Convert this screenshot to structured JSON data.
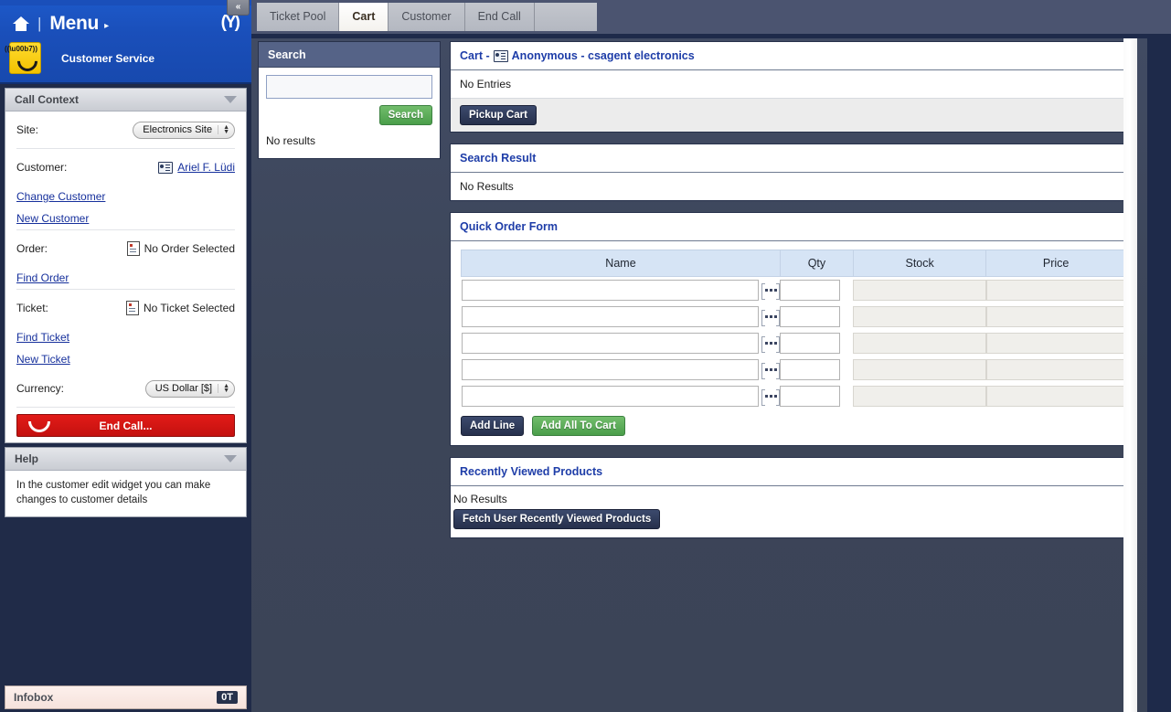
{
  "sidebar": {
    "menu_label": "Menu",
    "menu_arrow": "▸",
    "menu_divider": "|",
    "brand_mark": "(Ŷ)",
    "collapse_label": "«",
    "app_name": "Customer Service",
    "panels": {
      "call_context": {
        "title": "Call Context",
        "site_label": "Site:",
        "site_value": "Electronics Site",
        "customer_label": "Customer:",
        "customer_value": "Ariel F. Lüdi",
        "change_customer": "Change Customer",
        "new_customer": "New Customer",
        "order_label": "Order:",
        "order_value": "No Order Selected",
        "find_order": "Find Order",
        "ticket_label": "Ticket:",
        "ticket_value": "No Ticket Selected",
        "find_ticket": "Find Ticket",
        "new_ticket": "New Ticket",
        "currency_label": "Currency:",
        "currency_value": "US Dollar [$]",
        "end_call": "End Call..."
      },
      "help": {
        "title": "Help",
        "text": "In the customer edit widget you can make changes to customer details"
      }
    },
    "infobox": {
      "title": "Infobox",
      "badge": "0T"
    }
  },
  "tabs": [
    {
      "label": "Ticket Pool",
      "active": false
    },
    {
      "label": "Cart",
      "active": true
    },
    {
      "label": "Customer",
      "active": false
    },
    {
      "label": "End Call",
      "active": false
    }
  ],
  "search_widget": {
    "title": "Search",
    "input_value": "",
    "button_label": "Search",
    "result_text": "No results"
  },
  "cart": {
    "title_prefix": "Cart - ",
    "title_customer": "Anonymous - csagent electronics",
    "empty_text": "No Entries",
    "pickup_button": "Pickup Cart"
  },
  "search_result": {
    "title": "Search Result",
    "empty_text": "No Results"
  },
  "quick_order_form": {
    "title": "Quick Order Form",
    "columns": [
      "Name",
      "Qty",
      "Stock",
      "Price"
    ],
    "rows": [
      {
        "name": "",
        "qty": "",
        "stock": "",
        "price": ""
      },
      {
        "name": "",
        "qty": "",
        "stock": "",
        "price": ""
      },
      {
        "name": "",
        "qty": "",
        "stock": "",
        "price": ""
      },
      {
        "name": "",
        "qty": "",
        "stock": "",
        "price": ""
      },
      {
        "name": "",
        "qty": "",
        "stock": "",
        "price": ""
      }
    ],
    "add_line_button": "Add Line",
    "add_all_button": "Add All To Cart"
  },
  "recently_viewed": {
    "title": "Recently Viewed Products",
    "empty_text": "No Results",
    "fetch_button": "Fetch User Recently Viewed Products"
  },
  "colors": {
    "header_blue": "#1a4fba",
    "link_blue": "#16309c",
    "title_blue": "#1e3da8",
    "accent_red": "#c4110f",
    "accent_green": "#4a9e4a",
    "panel_dark": "#27314b",
    "background": "#3c4558"
  }
}
